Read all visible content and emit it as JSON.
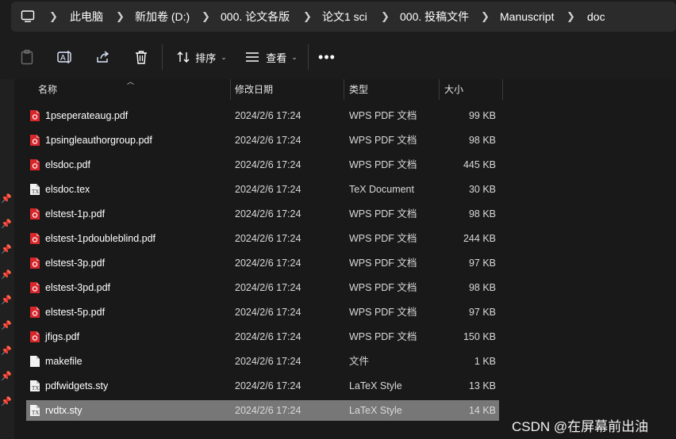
{
  "breadcrumb": [
    "此电脑",
    "新加卷 (D:)",
    "000. 论文各版",
    "论文1 sci",
    "000. 投稿文件",
    "Manuscript",
    "doc"
  ],
  "toolbar": {
    "sort_label": "排序",
    "view_label": "查看"
  },
  "columns": {
    "name": "名称",
    "date": "修改日期",
    "type": "类型",
    "size": "大小"
  },
  "files": [
    {
      "name": "1pseperateaug.pdf",
      "date": "2024/2/6 17:24",
      "type": "WPS PDF 文档",
      "size": "99 KB",
      "icon": "pdf-icon"
    },
    {
      "name": "1psingleauthorgroup.pdf",
      "date": "2024/2/6 17:24",
      "type": "WPS PDF 文档",
      "size": "98 KB",
      "icon": "pdf-icon"
    },
    {
      "name": "elsdoc.pdf",
      "date": "2024/2/6 17:24",
      "type": "WPS PDF 文档",
      "size": "445 KB",
      "icon": "pdf-icon"
    },
    {
      "name": "elsdoc.tex",
      "date": "2024/2/6 17:24",
      "type": "TeX Document",
      "size": "30 KB",
      "icon": "tex-icon"
    },
    {
      "name": "elstest-1p.pdf",
      "date": "2024/2/6 17:24",
      "type": "WPS PDF 文档",
      "size": "98 KB",
      "icon": "pdf-icon"
    },
    {
      "name": "elstest-1pdoubleblind.pdf",
      "date": "2024/2/6 17:24",
      "type": "WPS PDF 文档",
      "size": "244 KB",
      "icon": "pdf-icon"
    },
    {
      "name": "elstest-3p.pdf",
      "date": "2024/2/6 17:24",
      "type": "WPS PDF 文档",
      "size": "97 KB",
      "icon": "pdf-icon"
    },
    {
      "name": "elstest-3pd.pdf",
      "date": "2024/2/6 17:24",
      "type": "WPS PDF 文档",
      "size": "98 KB",
      "icon": "pdf-icon"
    },
    {
      "name": "elstest-5p.pdf",
      "date": "2024/2/6 17:24",
      "type": "WPS PDF 文档",
      "size": "97 KB",
      "icon": "pdf-icon"
    },
    {
      "name": "jfigs.pdf",
      "date": "2024/2/6 17:24",
      "type": "WPS PDF 文档",
      "size": "150 KB",
      "icon": "pdf-icon"
    },
    {
      "name": "makefile",
      "date": "2024/2/6 17:24",
      "type": "文件",
      "size": "1 KB",
      "icon": "file-icon"
    },
    {
      "name": "pdfwidgets.sty",
      "date": "2024/2/6 17:24",
      "type": "LaTeX Style",
      "size": "13 KB",
      "icon": "tex-icon"
    },
    {
      "name": "rvdtx.sty",
      "date": "2024/2/6 17:24",
      "type": "LaTeX Style",
      "size": "14 KB",
      "icon": "tex-icon",
      "selected": true
    }
  ],
  "watermark": "CSDN @在屏幕前出油",
  "colors": {
    "pdf_red": "#d9262b",
    "selected_row": "#777777",
    "background": "#1c1c1c"
  }
}
